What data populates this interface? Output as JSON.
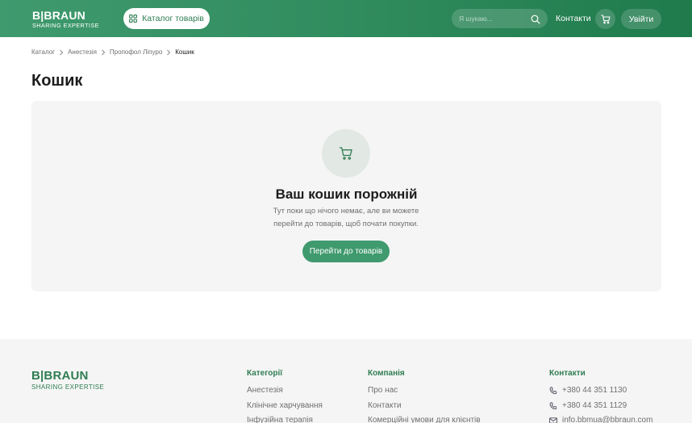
{
  "header": {
    "logo": {
      "brand": "B|BRAUN",
      "tagline": "SHARING EXPERTISE"
    },
    "catalog_label": "Каталог товарів",
    "search_placeholder": "Я шукаю...",
    "contacts_label": "Контакти",
    "login_label": "Увійти",
    "icons": [
      "grid-icon",
      "search-icon",
      "cart-icon"
    ]
  },
  "breadcrumb": [
    "Каталог",
    "Анестезія",
    "Пропофол Ліпуро",
    "Кошик"
  ],
  "page_title": "Кошик",
  "empty_cart": {
    "title": "Ваш кошик порожній",
    "text": "Тут поки що нічого немає, але ви можете перейти до товарів, щоб почати покупки.",
    "button": "Перейти до товарів"
  },
  "footer": {
    "logo": {
      "brand": "B|BRAUN",
      "tagline": "SHARING EXPERTISE"
    },
    "categories": {
      "title": "Категорії",
      "items": [
        "Анестезія",
        "Клінічне харчування",
        "Інфузійна терапія"
      ]
    },
    "company": {
      "title": "Компанія",
      "items": [
        "Про нас",
        "Контакти",
        "Комерційні умови для клієнтів"
      ]
    },
    "contacts": {
      "title": "Контакти",
      "phone1": "+380 44 351 1130",
      "phone2": "+380 44 351 1129",
      "email": "info.bbmua@bbraun.com"
    }
  },
  "colors": {
    "brand_green": "#2f7d52",
    "button_green": "#3f9a6e",
    "card_bg": "#f5f5f5",
    "icon_circle": "#e2e8e4"
  }
}
